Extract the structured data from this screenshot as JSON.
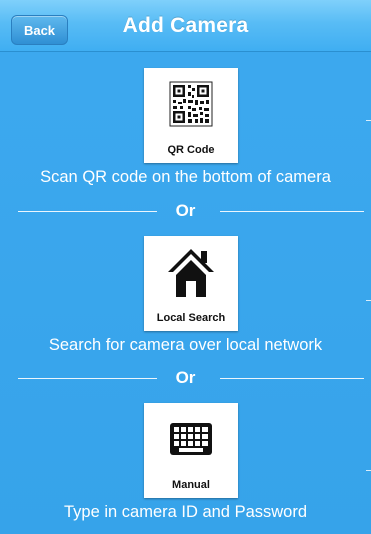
{
  "header": {
    "back_label": "Back",
    "title": "Add Camera"
  },
  "options": [
    {
      "icon": "qr-code-icon",
      "label": "QR Code",
      "caption": "Scan QR code on the bottom of camera"
    },
    {
      "icon": "house-icon",
      "label": "Local Search",
      "caption": "Search for camera over local network"
    },
    {
      "icon": "keyboard-icon",
      "label": "Manual",
      "caption": "Type in camera ID and Password"
    }
  ],
  "dividers": [
    {
      "label": "Or"
    },
    {
      "label": "Or"
    }
  ],
  "colors": {
    "background": "#3ba8ee",
    "header": "#58bcf5",
    "text": "#ffffff"
  }
}
